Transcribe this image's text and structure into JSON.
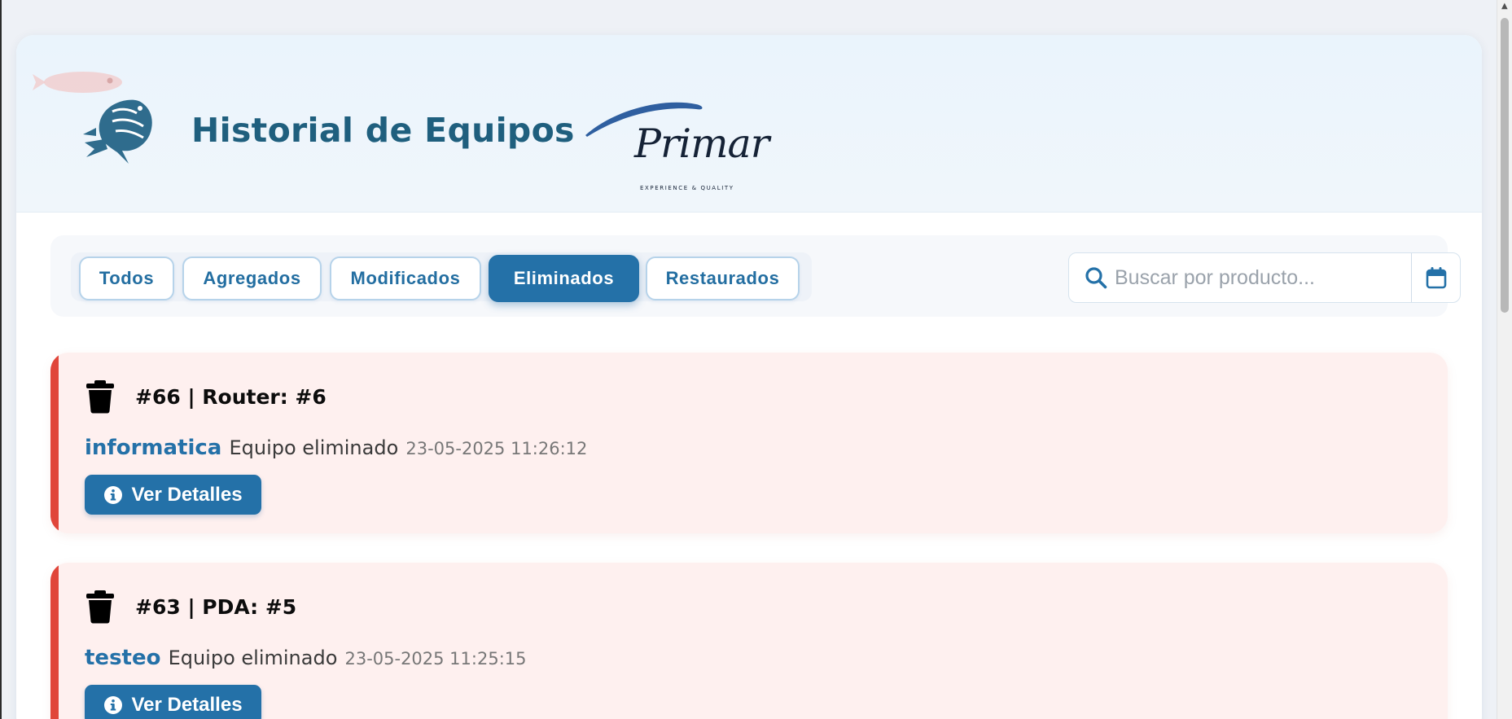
{
  "header": {
    "title": "Historial de Equipos",
    "brand_name": "Primar",
    "brand_tagline": "EXPERIENCE & QUALITY"
  },
  "filters": [
    {
      "label": "Todos",
      "active": false
    },
    {
      "label": "Agregados",
      "active": false
    },
    {
      "label": "Modificados",
      "active": false
    },
    {
      "label": "Eliminados",
      "active": true
    },
    {
      "label": "Restaurados",
      "active": false
    }
  ],
  "search": {
    "placeholder": "Buscar por producto...",
    "value": ""
  },
  "records": [
    {
      "title": "#66 | Router: #6",
      "user": "informatica",
      "action": "Equipo eliminado",
      "date": "23-05-2025 11:26:12",
      "button": "Ver Detalles"
    },
    {
      "title": "#63 | PDA: #5",
      "user": "testeo",
      "action": "Equipo eliminado",
      "date": "23-05-2025 11:25:15",
      "button": "Ver Detalles"
    }
  ],
  "colors": {
    "accent": "#2471a8",
    "title": "#1f5f7e",
    "deleted_accent": "#e0463a",
    "deleted_bg": "#fef0ef"
  },
  "icons": [
    "fish-logo-icon",
    "search-icon",
    "calendar-icon",
    "trash-icon",
    "info-circle-icon"
  ]
}
